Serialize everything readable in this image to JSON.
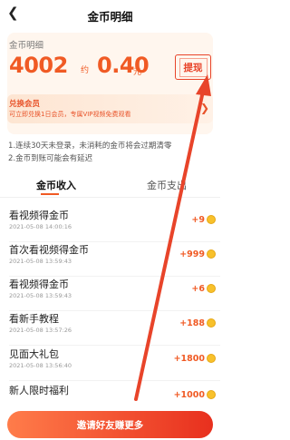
{
  "header": {
    "title": "金币明细",
    "back_icon": "chevron-left-icon"
  },
  "balance": {
    "label": "金币明细",
    "coins": "4002",
    "approx": "约",
    "money": "0.40",
    "unit": "元",
    "withdraw_label": "提现"
  },
  "vip": {
    "title": "兑换会员",
    "desc": "可立即兑换1日会员，专属VIP视频免费观看",
    "icon": "chevron-right-icon"
  },
  "notices": [
    "1.连续30天未登录，未消耗的金币将会过期清零",
    "2.金币到账可能会有延迟"
  ],
  "tabs": {
    "income": "金币收入",
    "expense": "金币支出",
    "active": "income"
  },
  "records": [
    {
      "title": "看视频得金币",
      "time": "2021-05-08 14:00:16",
      "amount": "+9"
    },
    {
      "title": "首次看视频得金币",
      "time": "2021-05-08 13:59:43",
      "amount": "+999"
    },
    {
      "title": "看视频得金币",
      "time": "2021-05-08 13:59:43",
      "amount": "+6"
    },
    {
      "title": "看新手教程",
      "time": "2021-05-08 13:57:26",
      "amount": "+188"
    },
    {
      "title": "见面大礼包",
      "time": "2021-05-08 13:56:40",
      "amount": "+1800"
    },
    {
      "title": "新人限时福利",
      "time": "",
      "amount": "+1000"
    }
  ],
  "invite": {
    "label": "邀请好友赚更多"
  },
  "colors": {
    "accent": "#f05a24",
    "annotation": "#e8442a",
    "coin": "#f8c12b"
  }
}
